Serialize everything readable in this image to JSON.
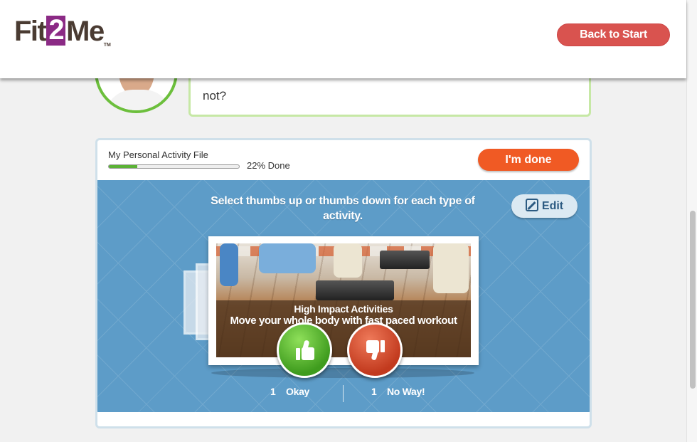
{
  "header": {
    "logo": {
      "part1": "Fit",
      "part2": "2",
      "part3": "Me",
      "tm": "TM"
    },
    "back_button": "Back to Start"
  },
  "coach": {
    "speech_text": "not?"
  },
  "activity_file": {
    "title": "My Personal Activity File",
    "progress_fraction": 0.22,
    "progress_text": "22% Done",
    "done_button": "I'm done"
  },
  "panel": {
    "instruction": "Select thumbs up or thumbs down for each type of activity.",
    "edit_button": "Edit",
    "card": {
      "title": "High Impact Activities",
      "subtitle": "Move your whole body with fast paced workout"
    },
    "okay": {
      "count": "1",
      "label": "Okay"
    },
    "noway": {
      "count": "1",
      "label": "No Way!"
    }
  },
  "colors": {
    "brand_purple": "#8b2a85",
    "back_button": "#d9534f",
    "done_button": "#f05a24",
    "panel_blue": "#5d9cc8",
    "progress_green": "#5bb236",
    "coach_green": "#6cbf3c"
  },
  "icons": [
    "edit-icon",
    "thumbs-up-icon",
    "thumbs-down-icon"
  ]
}
